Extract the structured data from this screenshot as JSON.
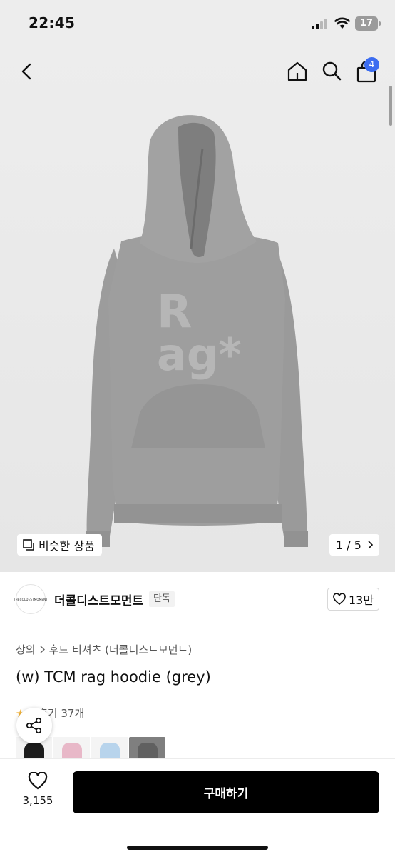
{
  "status_bar": {
    "time": "22:45",
    "battery": "17"
  },
  "header": {
    "cart_count": "4"
  },
  "gallery": {
    "similar_label": "비슷한 상품",
    "page_indicator": "1 / 5",
    "product_print": [
      "R",
      "ag*"
    ]
  },
  "brand": {
    "name": "더콜디스트모먼트",
    "tag": "단독",
    "logo_text": "THECOLDESTMOMENT",
    "likes": "13만"
  },
  "breadcrumb": [
    "상의",
    "후드 티셔츠 (더콜디스트모먼트)"
  ],
  "product": {
    "title": "(w) TCM rag hoodie (grey)"
  },
  "rating": {
    "score_visible": "1",
    "reviews": "후기 37개"
  },
  "bottom": {
    "favorite_count": "3,155",
    "buy_label": "구매하기"
  },
  "colors": {
    "accent_badge": "#3b6cf0",
    "hoodie_grey": "#9a9a9a",
    "buy_button": "#000000"
  },
  "swatches": [
    "black",
    "pink",
    "light-blue",
    "grey"
  ]
}
